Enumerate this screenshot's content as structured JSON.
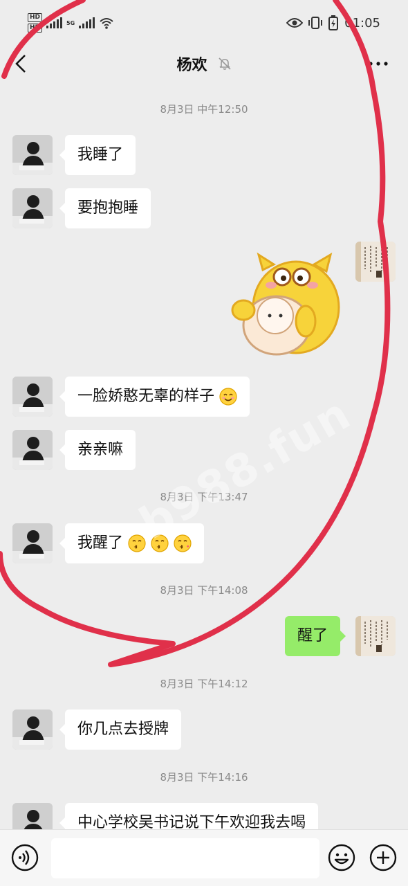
{
  "status_bar": {
    "hd_top": "HD",
    "hd_bottom": "HD",
    "network_label": "5G",
    "time": "01:05",
    "icons": [
      "eye-icon",
      "vibrate-icon",
      "battery-icon",
      "wifi-icon",
      "signal-icon"
    ]
  },
  "header": {
    "title": "杨欢",
    "back_icon": "chevron-left-icon",
    "mute_icon": "bell-off-icon",
    "more_icon": "more-horizontal-icon"
  },
  "messages": [
    {
      "kind": "time",
      "text": "8月3日 中午12:50"
    },
    {
      "kind": "text",
      "side": "left",
      "text": "我睡了"
    },
    {
      "kind": "text",
      "side": "left",
      "text": "要抱抱睡"
    },
    {
      "kind": "sticker",
      "side": "right",
      "description_icon": "hugging-cats-sticker"
    },
    {
      "kind": "text",
      "side": "left",
      "text": "一脸娇憨无辜的样子",
      "emoji": "smiling-face-emoji"
    },
    {
      "kind": "text",
      "side": "left",
      "text": "亲亲嘛"
    },
    {
      "kind": "time",
      "text": "8月3日 下午13:47"
    },
    {
      "kind": "text",
      "side": "left",
      "text": "我醒了",
      "emoji": "kissing-face-emoji x3"
    },
    {
      "kind": "time",
      "text": "8月3日 下午14:08"
    },
    {
      "kind": "text",
      "side": "right",
      "text": "醒了"
    },
    {
      "kind": "time",
      "text": "8月3日 下午14:12"
    },
    {
      "kind": "text",
      "side": "left",
      "text": "你几点去授牌"
    },
    {
      "kind": "time",
      "text": "8月3日 下午14:16"
    },
    {
      "kind": "text",
      "side": "left",
      "text": "中心学校吴书记说下午欢迎我去喝"
    }
  ],
  "input_bar": {
    "voice_icon": "voice-icon",
    "emoji_icon": "emoji-icon",
    "plus_icon": "plus-circle-icon",
    "placeholder": ""
  },
  "overlay": {
    "watermark": "b988.fun",
    "annotation_color": "#e0304a"
  },
  "colors": {
    "background": "#ededed",
    "bubble_left": "#ffffff",
    "bubble_right": "#95ec69",
    "time_text": "#8a8a8a"
  }
}
